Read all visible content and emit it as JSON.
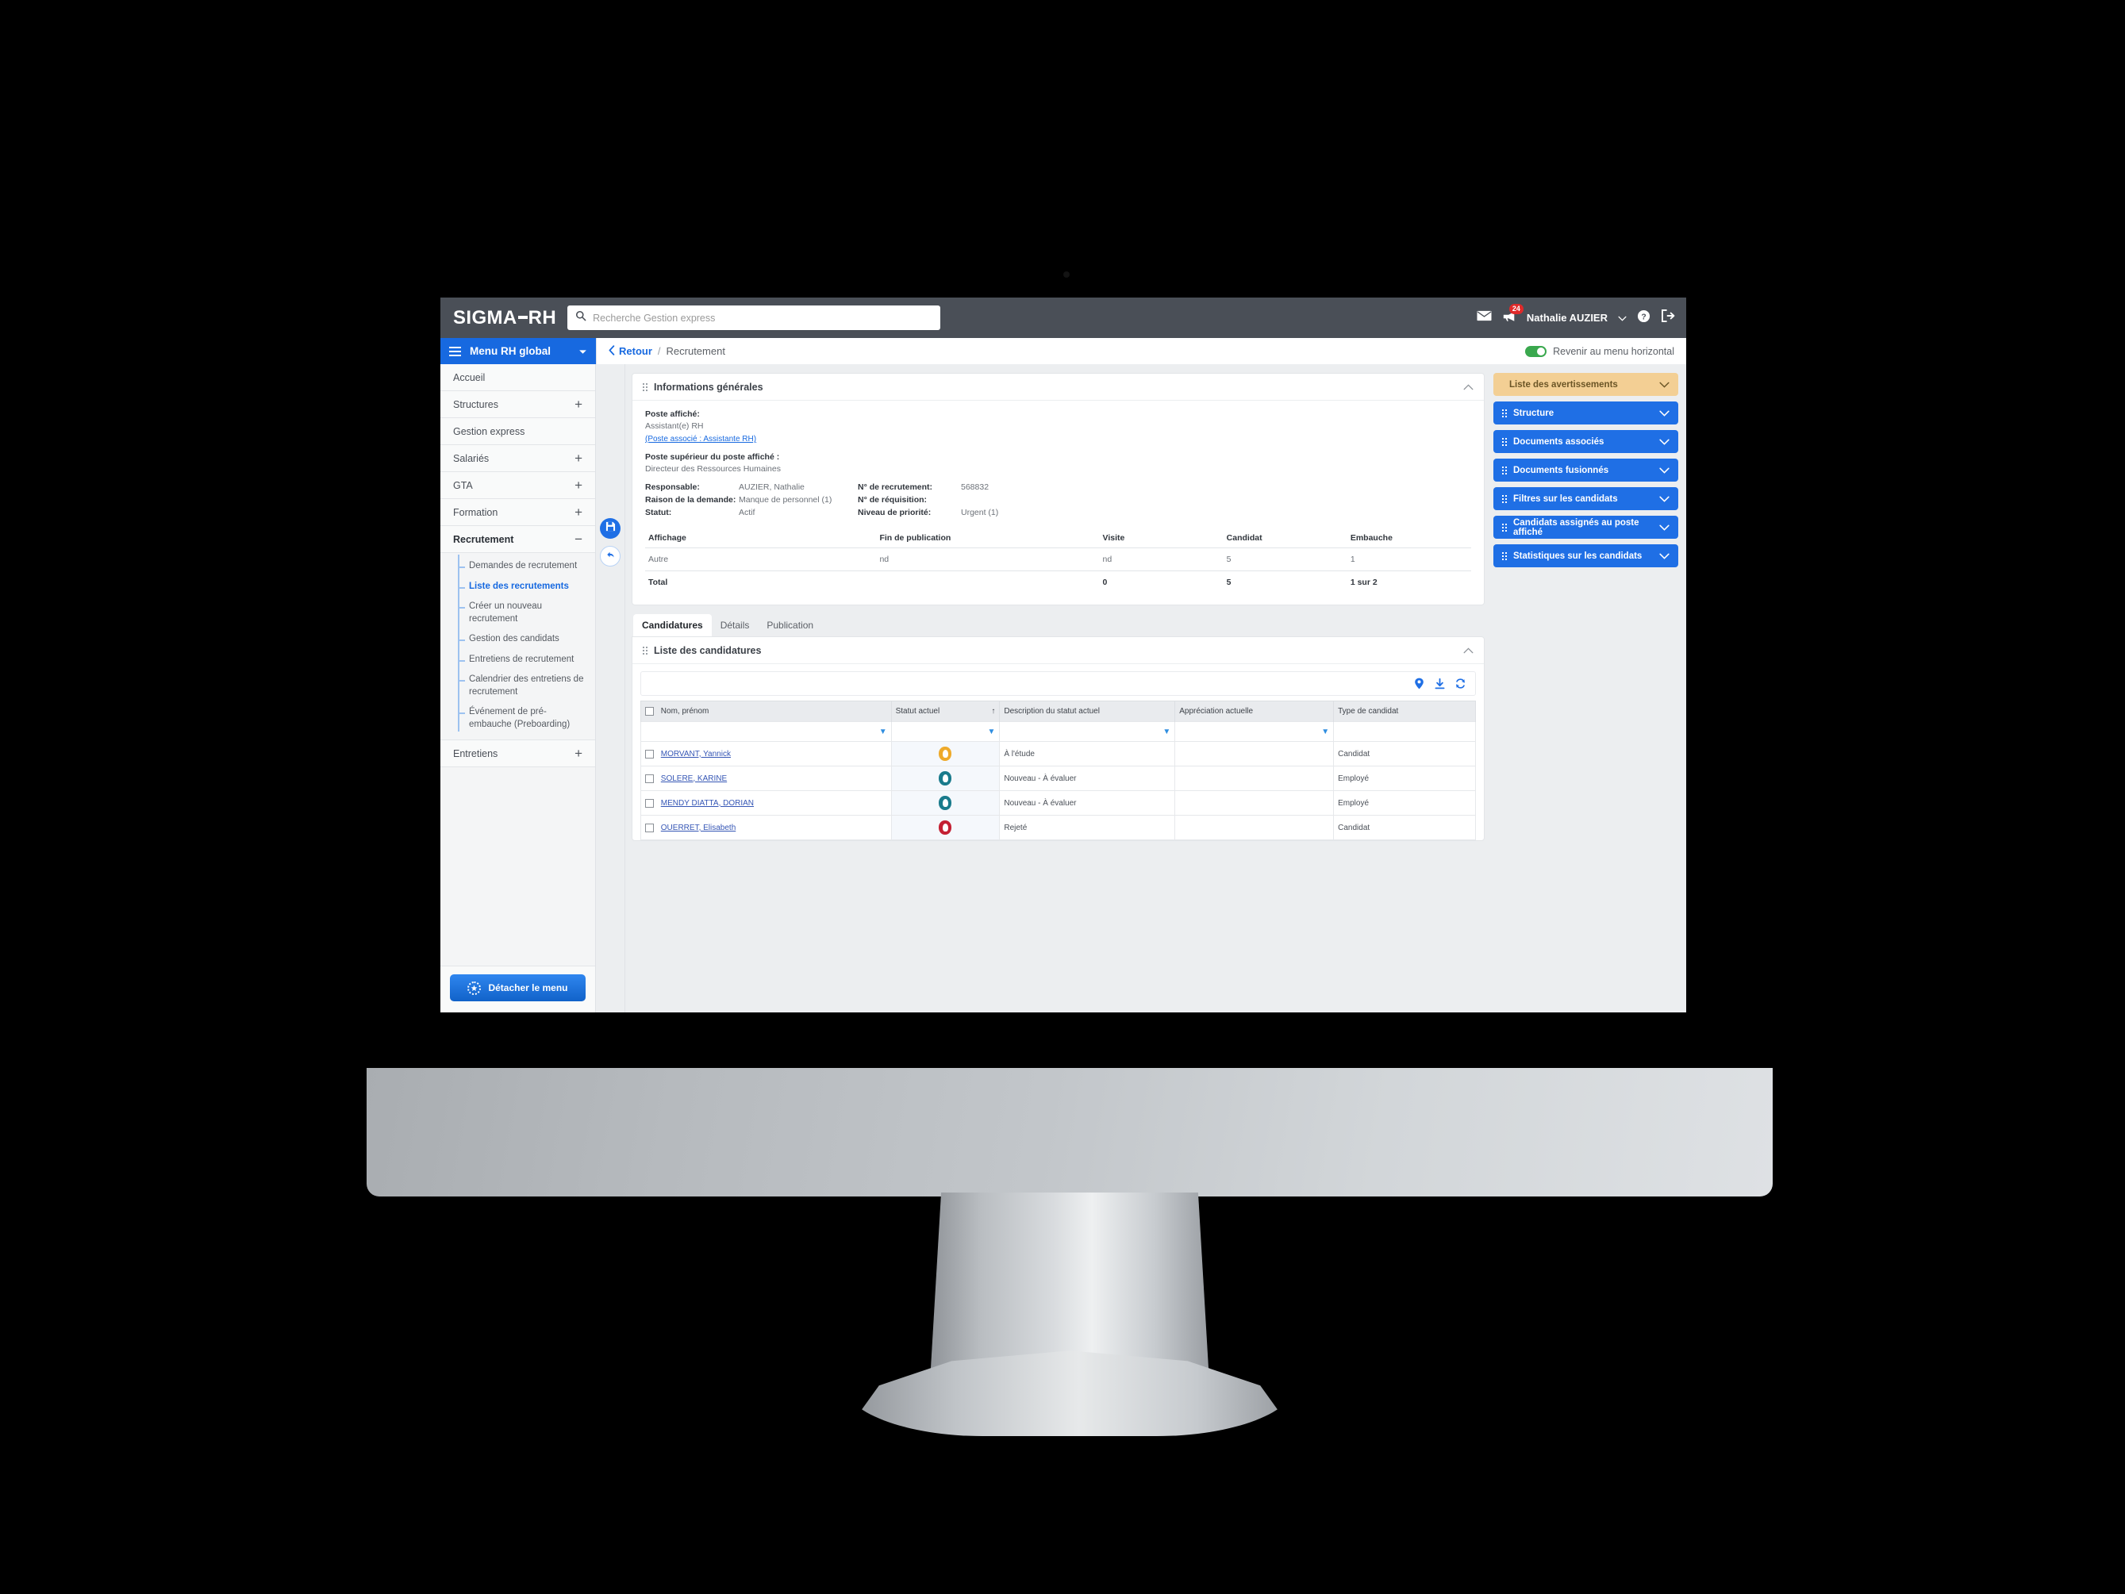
{
  "topbar": {
    "brand": "SIGMA",
    "brand_suffix": "RH",
    "search_placeholder": "Recherche Gestion express",
    "search_value": "",
    "mail_icon": "envelope-icon",
    "notification_icon": "megaphone-icon",
    "notification_count": "24",
    "user_name": "Nathalie AUZIER",
    "help_icon": "help-icon",
    "logout_icon": "logout-icon"
  },
  "menubar": {
    "menu_label": "Menu RH global",
    "back_label": "Retour",
    "separator": "/",
    "page_label": "Recrutement",
    "toggle_label": "Revenir au menu horizontal",
    "toggle_on": true
  },
  "sidebar": {
    "items": [
      {
        "label": "Accueil",
        "expander": ""
      },
      {
        "label": "Structures",
        "expander": "+"
      },
      {
        "label": "Gestion express",
        "expander": ""
      },
      {
        "label": "Salariés",
        "expander": "+"
      },
      {
        "label": "GTA",
        "expander": "+"
      },
      {
        "label": "Formation",
        "expander": "+"
      },
      {
        "label": "Recrutement",
        "expander": "−"
      }
    ],
    "submenu": [
      "Demandes de recrutement",
      "Liste des recrutements",
      "Créer un nouveau recrutement",
      "Gestion des candidats",
      "Entretiens de recrutement",
      "Calendrier des entretiens de recrutement",
      "Événement de pré-embauche (Preboarding)"
    ],
    "submenu_current": "Liste des recrutements",
    "last_item": {
      "label": "Entretiens",
      "expander": "+"
    },
    "detach_label": "Détacher le menu"
  },
  "action_rail": {
    "save_icon": "save-icon",
    "undo_icon": "undo-icon"
  },
  "info_card": {
    "title": "Informations générales",
    "poste_affiche_label": "Poste affiché:",
    "poste_affiche_value": "Assistant(e) RH",
    "poste_associe_link": "(Poste associé : Assistante RH)",
    "poste_superieur_label": "Poste supérieur du poste affiché :",
    "poste_superieur_value": "Directeur des Ressources Humaines",
    "fields": [
      {
        "label": "Responsable:",
        "value": "AUZIER, Nathalie"
      },
      {
        "label": "Raison de la demande:",
        "value": "Manque de personnel (1)"
      },
      {
        "label": "Statut:",
        "value": "Actif"
      }
    ],
    "fields_right": [
      {
        "label": "N° de recrutement:",
        "value": "568832"
      },
      {
        "label": "N° de réquisition:",
        "value": ""
      },
      {
        "label": "Niveau de priorité:",
        "value": "Urgent (1)"
      }
    ],
    "stats_headers": [
      "Affichage",
      "Fin de publication",
      "Visite",
      "Candidat",
      "Embauche"
    ],
    "stats_rows": [
      {
        "cells": [
          "Autre",
          "nd",
          "nd",
          "5",
          "1"
        ],
        "muted": true
      }
    ],
    "stats_total": {
      "cells": [
        "Total",
        "",
        "0",
        "5",
        "1 sur 2"
      ]
    }
  },
  "tabs": [
    {
      "label": "Candidatures",
      "active": true
    },
    {
      "label": "Détails",
      "active": false
    },
    {
      "label": "Publication",
      "active": false
    }
  ],
  "candidatures": {
    "title": "Liste des candidatures",
    "toolbar_icons": [
      "map-pin-icon",
      "download-icon",
      "refresh-icon"
    ],
    "columns": [
      "Nom, prénom",
      "Statut actuel",
      "Description du statut actuel",
      "Appréciation actuelle",
      "Type de candidat"
    ],
    "sort_indicator": "↑",
    "rows": [
      {
        "name": "MORVANT, Yannick",
        "status_color": "#eeaa2b",
        "description": "À l'étude",
        "appreciation": "",
        "type": "Candidat"
      },
      {
        "name": "SOLERE, KARINE",
        "status_color": "#1a7b8c",
        "description": "Nouveau - À évaluer",
        "appreciation": "",
        "type": "Employé"
      },
      {
        "name": "MENDY DIATTA, DORIAN",
        "status_color": "#1a7b8c",
        "description": "Nouveau - À évaluer",
        "appreciation": "",
        "type": "Employé"
      },
      {
        "name": "OUERRET, Elisabeth",
        "status_color": "#c42034",
        "description": "Rejeté",
        "appreciation": "",
        "type": "Candidat"
      }
    ]
  },
  "right_panels": [
    {
      "label": "Liste des avertissements",
      "style": "warn"
    },
    {
      "label": "Structure",
      "style": "blue"
    },
    {
      "label": "Documents associés",
      "style": "blue"
    },
    {
      "label": "Documents fusionnés",
      "style": "blue"
    },
    {
      "label": "Filtres sur les candidats",
      "style": "blue"
    },
    {
      "label": "Candidats assignés au poste affiché",
      "style": "blue"
    },
    {
      "label": "Statistiques sur les candidats",
      "style": "blue"
    }
  ]
}
